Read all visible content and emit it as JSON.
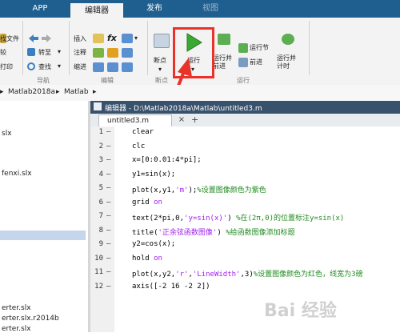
{
  "tabs": [
    "APP",
    "编辑器",
    "发布",
    "视图"
  ],
  "ribbon": {
    "file_col": [
      "找文件",
      "较",
      "打印"
    ],
    "nav_col": [
      "转至",
      "查找"
    ],
    "nav_group": "导航",
    "edit_col1": [
      "插入",
      "注释",
      "缩进"
    ],
    "edit_icons": [
      "fx"
    ],
    "edit_group": "编辑",
    "breakpoint_label": "断点",
    "breakpoint_group": "断点",
    "run_label": "运行",
    "run_advance_label": "运行并前进",
    "run_section_label": "运行节",
    "advance_label": "前进",
    "run_time_label": "运行并计时",
    "run_group": "运行",
    "brand_color": "#1e5f8f",
    "highlight_color": "#e8322a"
  },
  "address": [
    "Matlab2018a",
    "Matlab"
  ],
  "left_files": [
    "slx",
    "fenxi.slx",
    "erter.slx",
    "erter.slx.r2014b",
    "erter.slx"
  ],
  "editor": {
    "title": "编辑器 - D:\\Matlab2018a\\Matlab\\untitled3.m",
    "tab": "untitled3.m",
    "tab_add": "+",
    "lines": [
      {
        "n": "1",
        "dash": "—",
        "parts": [
          {
            "t": "clear",
            "c": ""
          }
        ]
      },
      {
        "n": "2",
        "dash": "—",
        "parts": [
          {
            "t": "clc",
            "c": ""
          }
        ]
      },
      {
        "n": "3",
        "dash": "—",
        "parts": [
          {
            "t": "x=[0:0.01:4*pi];",
            "c": ""
          }
        ]
      },
      {
        "n": "4",
        "dash": "—",
        "parts": [
          {
            "t": "y1=sin(x);",
            "c": ""
          }
        ]
      },
      {
        "n": "5",
        "dash": "—",
        "parts": [
          {
            "t": "plot(x,y1,",
            "c": ""
          },
          {
            "t": "'m'",
            "c": "st"
          },
          {
            "t": ");",
            "c": ""
          },
          {
            "t": "%设置图像颜色为紫色",
            "c": "cm"
          }
        ]
      },
      {
        "n": "6",
        "dash": "—",
        "parts": [
          {
            "t": "grid ",
            "c": ""
          },
          {
            "t": "on",
            "c": "st"
          }
        ]
      },
      {
        "n": "7",
        "dash": "—",
        "parts": [
          {
            "t": "text(2*pi,0,",
            "c": ""
          },
          {
            "t": "'y=sin(x)'",
            "c": "st"
          },
          {
            "t": ") ",
            "c": ""
          },
          {
            "t": "%在(2π,0)的位置标注y=sin(x)",
            "c": "cm"
          }
        ]
      },
      {
        "n": "8",
        "dash": "—",
        "parts": [
          {
            "t": "title(",
            "c": ""
          },
          {
            "t": "'正余弦函数图像'",
            "c": "st"
          },
          {
            "t": ") ",
            "c": ""
          },
          {
            "t": "%给函数图像添加标题",
            "c": "cm"
          }
        ]
      },
      {
        "n": "9",
        "dash": "—",
        "parts": [
          {
            "t": "y2=cos(x);",
            "c": ""
          }
        ]
      },
      {
        "n": "10",
        "dash": "—",
        "parts": [
          {
            "t": "hold ",
            "c": ""
          },
          {
            "t": "on",
            "c": "st"
          }
        ]
      },
      {
        "n": "11",
        "dash": "—",
        "parts": [
          {
            "t": "plot(x,y2,",
            "c": ""
          },
          {
            "t": "'r'",
            "c": "st"
          },
          {
            "t": ",",
            "c": ""
          },
          {
            "t": "'LineWidth'",
            "c": "st"
          },
          {
            "t": ",3)",
            "c": ""
          },
          {
            "t": "%设置图像颜色为红色，线宽为3磅",
            "c": "cm"
          }
        ]
      },
      {
        "n": "12",
        "dash": "—",
        "parts": [
          {
            "t": "axis([-2 16 -2 2])",
            "c": ""
          }
        ]
      }
    ]
  },
  "watermark": "Bai 经验"
}
